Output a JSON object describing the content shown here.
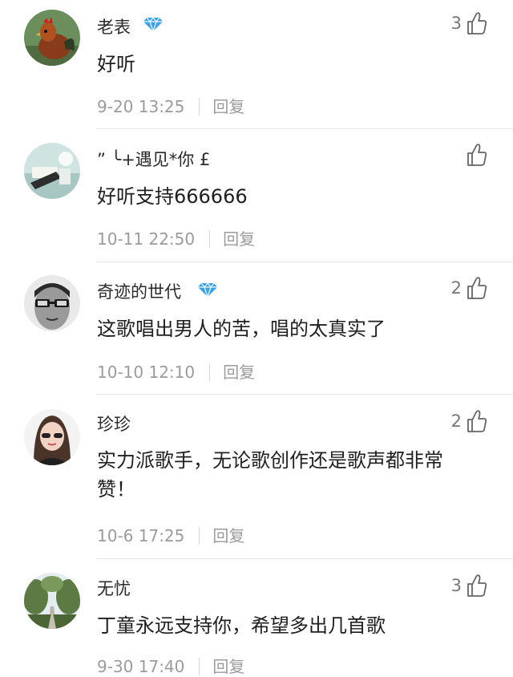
{
  "comments": [
    {
      "name": "老表",
      "badge": true,
      "text": "好听",
      "time": "9-20 13:25",
      "reply": "回复",
      "likes": "3"
    },
    {
      "name": "” ╰+遇见*你 £",
      "badge": false,
      "text": "好听支持666666",
      "time": "10-11 22:50",
      "reply": "回复",
      "likes": ""
    },
    {
      "name": "奇迹的世代",
      "badge": true,
      "text": "这歌唱出男人的苦，唱的太真实了",
      "time": "10-10 12:10",
      "reply": "回复",
      "likes": "2"
    },
    {
      "name": "珍珍",
      "badge": false,
      "text": "实力派歌手，无论歌创作还是歌声都非常赞！",
      "time": "10-6 17:25",
      "reply": "回复",
      "likes": "2"
    },
    {
      "name": "无忧",
      "badge": false,
      "text": "丁童永远支持你，希望多出几首歌",
      "time": "9-30 17:40",
      "reply": "回复",
      "likes": "3"
    }
  ]
}
